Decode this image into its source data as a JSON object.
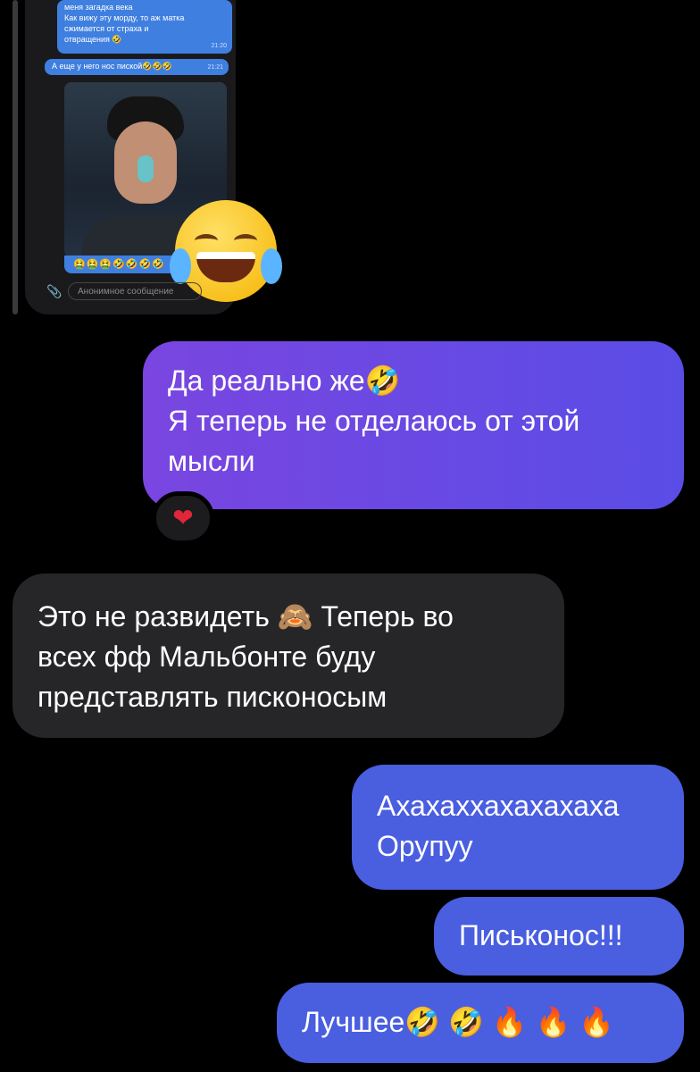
{
  "story": {
    "lines": [
      "меня загадка века",
      "Как вижу эту морду, то аж матка",
      "сжимается от страха и",
      "отвращения 🤣"
    ],
    "time1": "21:20",
    "line2": "А еще у него нос пиской🤣🤣🤣",
    "time2": "21:21",
    "emoji_row": "🤮🤮🤮🤣🤣🤣🤣",
    "anon_placeholder": "Анонимное сообщение"
  },
  "messages": {
    "out1": {
      "lines": [
        "Да реально же🤣",
        "Я теперь не отделаюсь от этой",
        "мысли"
      ],
      "reaction": "❤"
    },
    "in1": {
      "lines": [
        "Это не развидеть 🙈 Теперь во",
        "всех фф Мальбонте буду",
        "представлять писконосым"
      ]
    },
    "out2": {
      "lines": [
        "Ахахаххахахахаха",
        "Орупуу"
      ]
    },
    "out3": {
      "lines": [
        "Писькoнос!!!"
      ]
    },
    "out4": {
      "lines": [
        "Лучшее🤣 🤣 🔥 🔥 🔥"
      ]
    }
  },
  "icons": [
    "clip-icon",
    "heart-icon",
    "tears-of-joy-emoji"
  ]
}
